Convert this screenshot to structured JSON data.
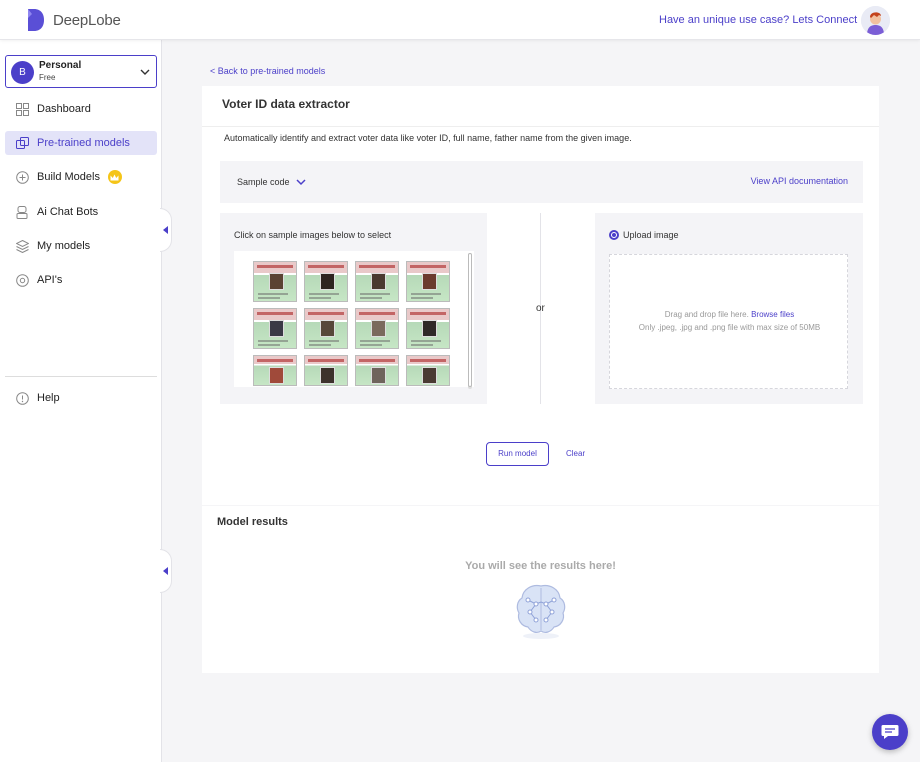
{
  "header": {
    "brand": "DeepLobe",
    "connect_link": "Have an unique use case? Lets Connect"
  },
  "sidebar": {
    "account": {
      "initial": "B",
      "name": "Personal",
      "plan": "Free"
    },
    "items": [
      {
        "label": "Dashboard",
        "icon": "dashboard-icon"
      },
      {
        "label": "Pre-trained models",
        "icon": "pretrained-models-icon",
        "active": true
      },
      {
        "label": "Build Models",
        "icon": "build-models-icon",
        "badge": "crown-icon"
      },
      {
        "label": "Ai Chat Bots",
        "icon": "chat-bot-icon"
      },
      {
        "label": "My models",
        "icon": "my-models-icon"
      },
      {
        "label": "API's",
        "icon": "api-icon"
      }
    ],
    "help": {
      "label": "Help",
      "icon": "help-icon"
    }
  },
  "main": {
    "back_link": "< Back to pre-trained models",
    "title": "Voter ID data extractor",
    "description": "Automatically identify and extract voter data like voter ID, full name, father name from the given image.",
    "sample_code_label": "Sample code",
    "api_doc_link": "View API documentation",
    "samples_label": "Click on sample images below to select",
    "or_text": "or",
    "upload_label": "Upload image",
    "drop_text": "Drag and drop file here.",
    "browse_text": "Browse files",
    "file_hint": "Only .jpeg, .jpg and .png file with max size of 50MB",
    "run_button": "Run model",
    "clear_button": "Clear"
  },
  "results": {
    "title": "Model results",
    "empty_text": "You will see the results here!"
  },
  "colors": {
    "accent": "#4b3fc9",
    "crown": "#f5c518"
  }
}
